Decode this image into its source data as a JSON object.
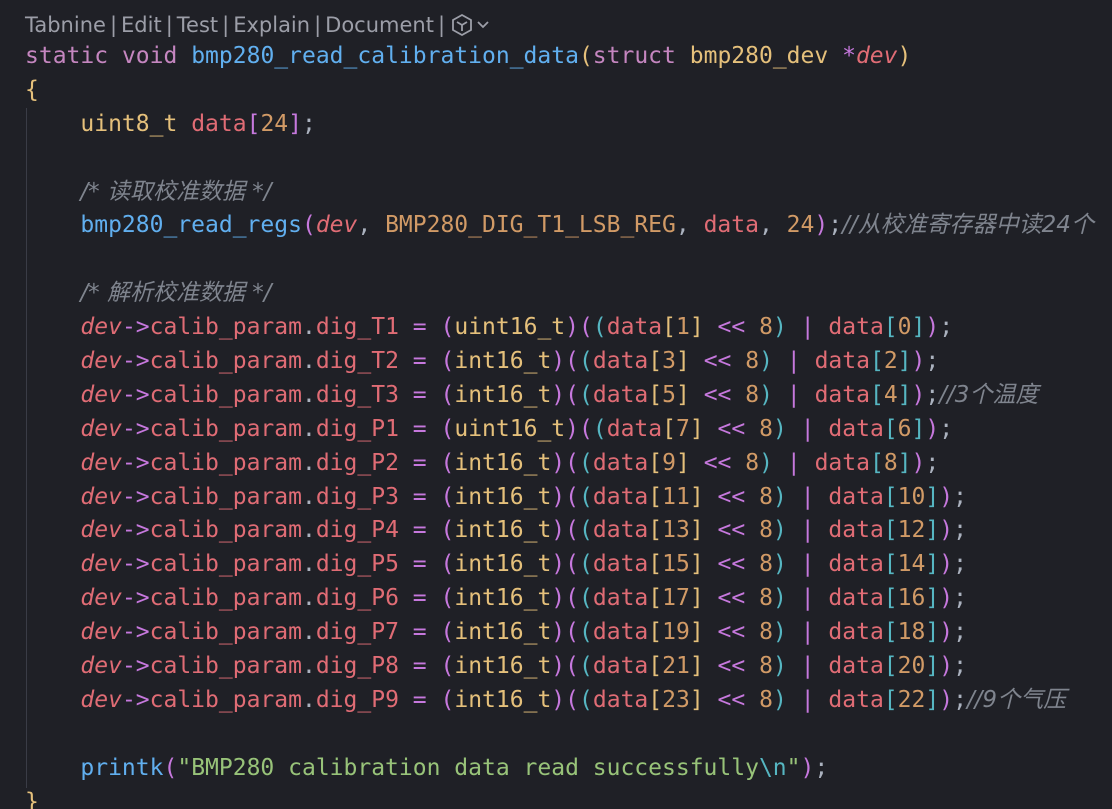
{
  "codelens": {
    "items": [
      "Tabnine",
      "Edit",
      "Test",
      "Explain",
      "Document"
    ],
    "separator": "|",
    "icon": "tabnine-chevron-icon"
  },
  "code": {
    "signature": {
      "static": "static",
      "void": "void",
      "name": "bmp280_read_calibration_data",
      "struct": "struct",
      "type": "bmp280_dev",
      "star": "*",
      "param": "dev"
    },
    "open_brace": "{",
    "close_brace": "}",
    "decl": {
      "type": "uint8_t",
      "var": "data",
      "size": "24"
    },
    "comment_read": "/* 读取校准数据 */",
    "read_call": {
      "fn": "bmp280_read_regs",
      "arg1": "dev",
      "macro": "BMP280_DIG_T1_LSB_REG",
      "arg3": "data",
      "arg4": "24",
      "comment": "//从校准寄存器中读24个"
    },
    "comment_parse": "/* 解析校准数据 */",
    "assignments": [
      {
        "field": "dig_T1",
        "cast": "uint16_t",
        "hi": "1",
        "lo": "0",
        "comment": ""
      },
      {
        "field": "dig_T2",
        "cast": "int16_t",
        "hi": "3",
        "lo": "2",
        "comment": ""
      },
      {
        "field": "dig_T3",
        "cast": "int16_t",
        "hi": "5",
        "lo": "4",
        "comment": "//3个温度"
      },
      {
        "field": "dig_P1",
        "cast": "uint16_t",
        "hi": "7",
        "lo": "6",
        "comment": ""
      },
      {
        "field": "dig_P2",
        "cast": "int16_t",
        "hi": "9",
        "lo": "8",
        "comment": ""
      },
      {
        "field": "dig_P3",
        "cast": "int16_t",
        "hi": "11",
        "lo": "10",
        "comment": ""
      },
      {
        "field": "dig_P4",
        "cast": "int16_t",
        "hi": "13",
        "lo": "12",
        "comment": ""
      },
      {
        "field": "dig_P5",
        "cast": "int16_t",
        "hi": "15",
        "lo": "14",
        "comment": ""
      },
      {
        "field": "dig_P6",
        "cast": "int16_t",
        "hi": "17",
        "lo": "16",
        "comment": ""
      },
      {
        "field": "dig_P7",
        "cast": "int16_t",
        "hi": "19",
        "lo": "18",
        "comment": ""
      },
      {
        "field": "dig_P8",
        "cast": "int16_t",
        "hi": "21",
        "lo": "20",
        "comment": ""
      },
      {
        "field": "dig_P9",
        "cast": "int16_t",
        "hi": "23",
        "lo": "22",
        "comment": "//9个气压"
      }
    ],
    "assign_parts": {
      "dev": "dev",
      "arrow": "->",
      "calib": "calib_param",
      "shift": "<<",
      "eight": "8",
      "pipe": "|",
      "data": "data"
    },
    "printk": {
      "fn": "printk",
      "string": "\"BMP280 calibration data read successfully",
      "escape": "\\n",
      "quote_end": "\""
    }
  },
  "colors": {
    "background": "#1f2026",
    "keyword": "#c586c0",
    "type": "#e5c07b",
    "function": "#61afef",
    "variable": "#e06c75",
    "number": "#d19a66",
    "string": "#98c379",
    "comment": "#7f848e"
  }
}
